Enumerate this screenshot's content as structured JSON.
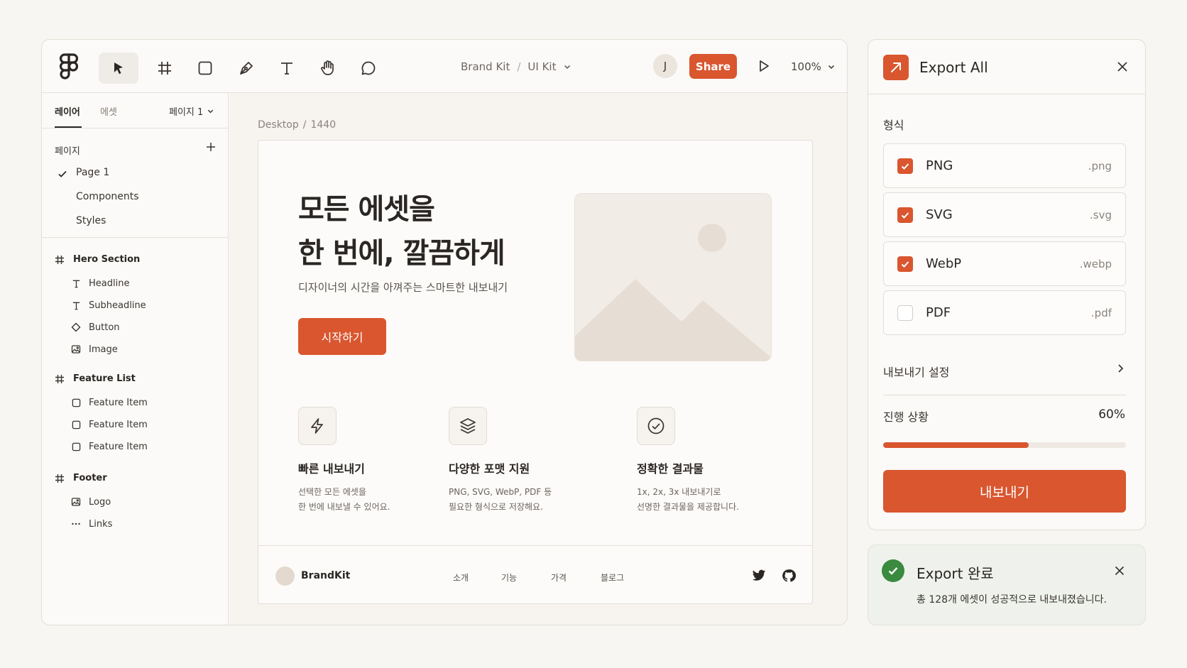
{
  "toolbar": {
    "breadcrumb": [
      "Brand Kit",
      "UI Kit"
    ],
    "breadcrumb_sep": "/",
    "avatar_initial": "J",
    "share_label": "Share",
    "zoom": "100%"
  },
  "left_panel": {
    "tabs": [
      "레이어",
      "에셋"
    ],
    "page_select": "페이지 1",
    "pages_header": "페이지",
    "pages": [
      "Page 1",
      "Components",
      "Styles"
    ],
    "layers": [
      {
        "group": "Hero Section",
        "items": [
          {
            "label": "Headline",
            "icon": "text-icon"
          },
          {
            "label": "Subheadline",
            "icon": "text-icon"
          },
          {
            "label": "Button",
            "icon": "component-icon"
          },
          {
            "label": "Image",
            "icon": "image-icon"
          }
        ]
      },
      {
        "group": "Feature List",
        "items": [
          {
            "label": "Feature Item",
            "icon": "rectangle-icon"
          },
          {
            "label": "Feature Item",
            "icon": "rectangle-icon"
          },
          {
            "label": "Feature Item",
            "icon": "rectangle-icon"
          }
        ]
      },
      {
        "group": "Footer",
        "items": [
          {
            "label": "Logo",
            "icon": "image-icon"
          },
          {
            "label": "Links",
            "icon": "more-icon"
          }
        ]
      }
    ]
  },
  "canvas": {
    "frame_label": [
      "Desktop",
      "/",
      "1440"
    ],
    "hero": {
      "headline_line1": "모든 에셋을",
      "headline_line2": "한 번에, 깔끔하게",
      "subheadline": "디자이너의 시간을 아껴주는 스마트한 내보내기",
      "cta": "시작하기"
    },
    "features": [
      {
        "title": "빠른 내보내기",
        "desc1": "선택한 모든 에셋을",
        "desc2": "한 번에 내보낼 수 있어요.",
        "icon": "lightning-icon"
      },
      {
        "title": "다양한 포맷 지원",
        "desc1": "PNG, SVG, WebP, PDF 등",
        "desc2": "필요한 형식으로 저장해요.",
        "icon": "layers-icon"
      },
      {
        "title": "정확한 결과물",
        "desc1": "1x, 2x, 3x 내보내기로",
        "desc2": "선명한 결과물을 제공합니다.",
        "icon": "check-circle-icon"
      }
    ],
    "footer": {
      "brand": "BrandKit",
      "links": [
        "소개",
        "기능",
        "가격",
        "블로그"
      ]
    }
  },
  "export_panel": {
    "title": "Export All",
    "format_label": "형식",
    "formats": [
      {
        "name": "PNG",
        "ext": ".png",
        "checked": true
      },
      {
        "name": "SVG",
        "ext": ".svg",
        "checked": true
      },
      {
        "name": "WebP",
        "ext": ".webp",
        "checked": true
      },
      {
        "name": "PDF",
        "ext": ".pdf",
        "checked": false
      }
    ],
    "settings_label": "내보내기 설정",
    "progress_label": "진행 상황",
    "progress_value": "60%",
    "progress_fraction": 0.6,
    "export_button": "내보내기"
  },
  "toast": {
    "title": "Export 완료",
    "message": "총 128개 에셋이 성공적으로 내보내졌습니다."
  },
  "colors": {
    "accent": "#d9562f",
    "success": "#3a8a3f",
    "background": "#f8f6f2"
  }
}
